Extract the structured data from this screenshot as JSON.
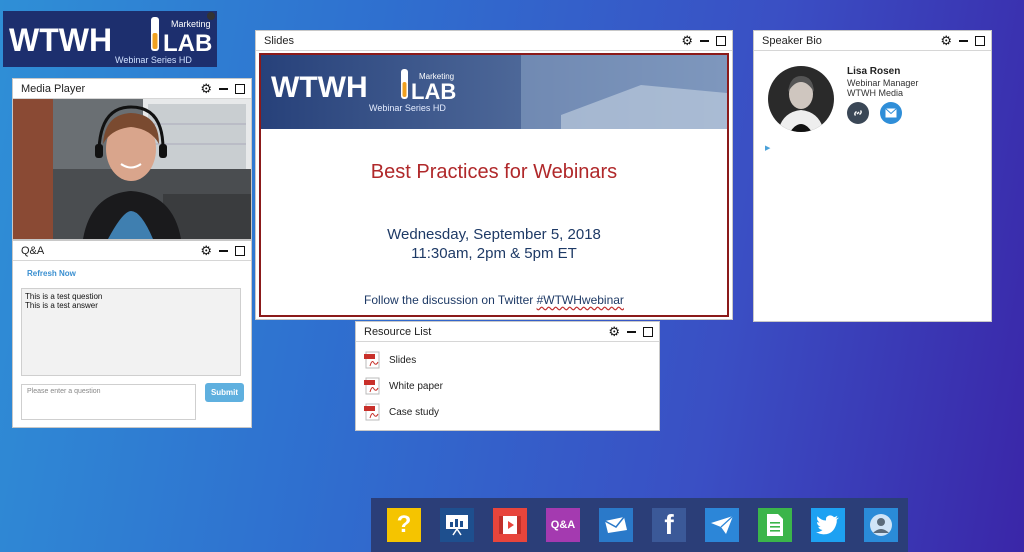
{
  "logo": {
    "text": "WTWH",
    "lab": "LAB",
    "marketing": "Marketing",
    "series": "Webinar Series HD"
  },
  "windows": {
    "media_player": {
      "title": "Media Player"
    },
    "qa": {
      "title": "Q&A",
      "refresh": "Refresh Now",
      "question": "This is a test question",
      "answer": "This is a test answer",
      "input_placeholder": "Please enter a question",
      "submit": "Submit"
    },
    "slides": {
      "title": "Slides",
      "banner": {
        "text": "WTWH",
        "lab": "LAB",
        "marketing": "Marketing",
        "series": "Webinar Series HD"
      },
      "heading": "Best Practices for Webinars",
      "date": "Wednesday, September 5, 2018",
      "time": "11:30am, 2pm & 5pm ET",
      "follow_prefix": "Follow the discussion on Twitter ",
      "hashtag": "#WTWHwebinar"
    },
    "speaker_bio": {
      "title": "Speaker Bio",
      "name": "Lisa Rosen",
      "role": "Webinar Manager",
      "org": "WTWH Media"
    },
    "resource_list": {
      "title": "Resource List",
      "items": [
        "Slides",
        "White paper",
        "Case study"
      ]
    }
  },
  "toolbar": {
    "icons": [
      "help-icon",
      "slides-icon",
      "video-icon",
      "qa-icon",
      "email-icon",
      "facebook-icon",
      "send-icon",
      "document-icon",
      "twitter-icon",
      "profile-icon"
    ],
    "qa_label": "Q&A",
    "help_label": "?",
    "facebook_label": "f"
  },
  "colors": {
    "accent_red": "#b0282a",
    "navy": "#1e3a66",
    "link_blue": "#3a8fd0",
    "toolbar_bg": "#2b3e78"
  }
}
